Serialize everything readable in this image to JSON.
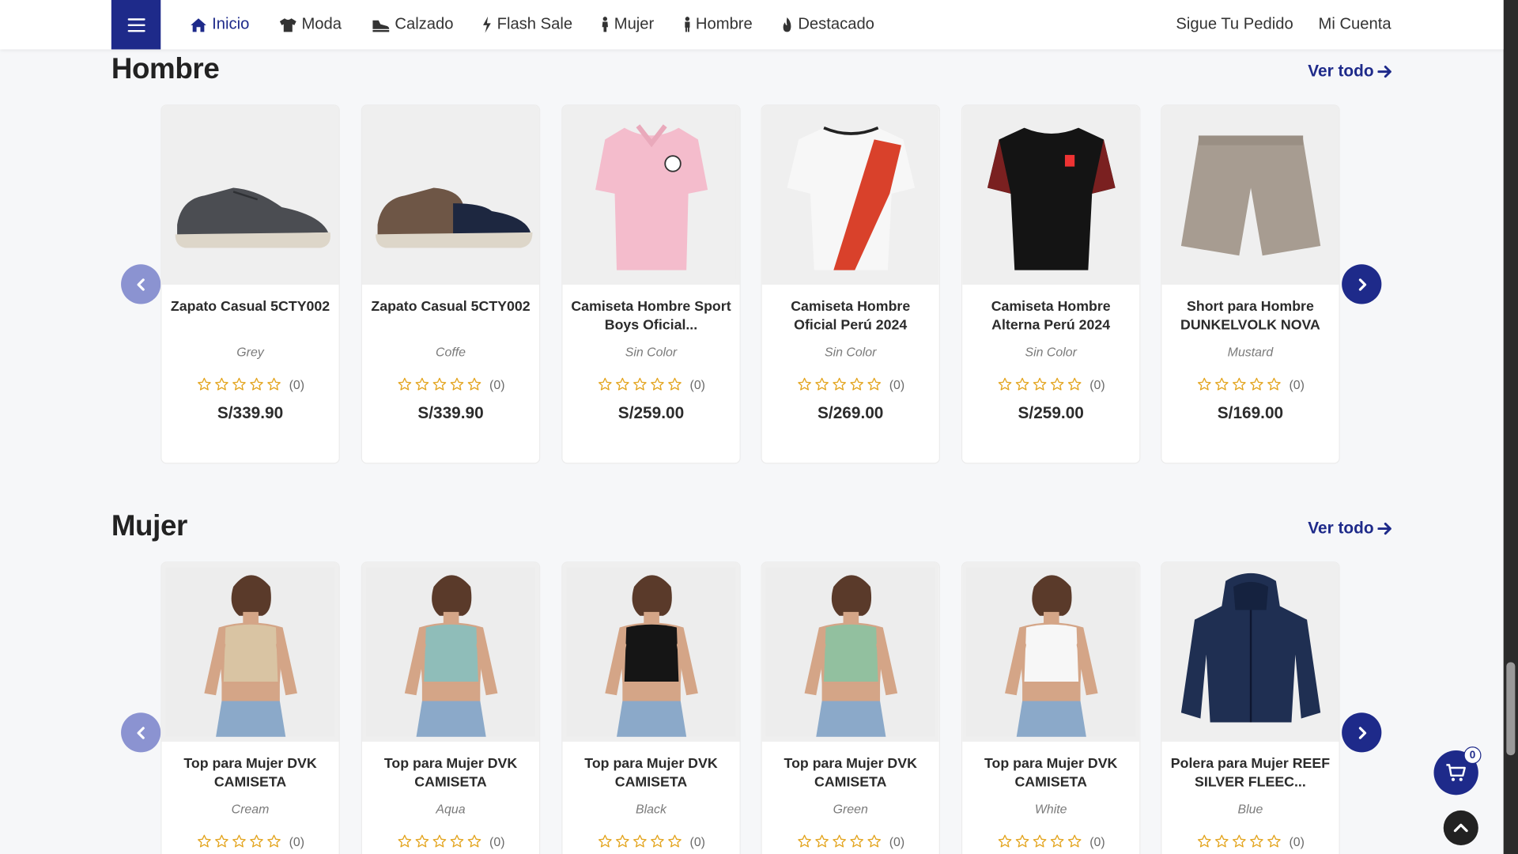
{
  "nav": {
    "items": [
      {
        "label": "Inicio",
        "icon": "home-icon",
        "active": true
      },
      {
        "label": "Moda",
        "icon": "shirt-icon"
      },
      {
        "label": "Calzado",
        "icon": "shoe-icon"
      },
      {
        "label": "Flash Sale",
        "icon": "bolt-icon"
      },
      {
        "label": "Mujer",
        "icon": "female-icon"
      },
      {
        "label": "Hombre",
        "icon": "male-icon"
      },
      {
        "label": "Destacado",
        "icon": "fire-icon"
      }
    ],
    "right": {
      "track": "Sigue Tu Pedido",
      "account": "Mi Cuenta"
    }
  },
  "sections": [
    {
      "title": "Hombre",
      "see_all": "Ver todo",
      "products": [
        {
          "name": "Zapato Casual 5CTY002",
          "variant": "Grey",
          "reviews": "(0)",
          "price": "S/339.90",
          "image": "shoe-grey"
        },
        {
          "name": "Zapato Casual 5CTY002",
          "variant": "Coffe",
          "reviews": "(0)",
          "price": "S/339.90",
          "image": "shoe-coffee"
        },
        {
          "name": "Camiseta Hombre Sport Boys Oficial...",
          "variant": "Sin Color",
          "reviews": "(0)",
          "price": "S/259.00",
          "image": "shirt-pink"
        },
        {
          "name": "Camiseta Hombre Oficial Perú 2024",
          "variant": "Sin Color",
          "reviews": "(0)",
          "price": "S/269.00",
          "image": "shirt-peru-white"
        },
        {
          "name": "Camiseta Hombre Alterna Perú 2024",
          "variant": "Sin Color",
          "reviews": "(0)",
          "price": "S/259.00",
          "image": "shirt-peru-black"
        },
        {
          "name": "Short para Hombre DUNKELVOLK NOVA",
          "variant": "Mustard",
          "reviews": "(0)",
          "price": "S/169.00",
          "image": "shorts-khaki"
        }
      ]
    },
    {
      "title": "Mujer",
      "see_all": "Ver todo",
      "products": [
        {
          "name": "Top para Mujer DVK CAMISETA",
          "variant": "Cream",
          "reviews": "(0)",
          "image": "top-cream"
        },
        {
          "name": "Top para Mujer DVK CAMISETA",
          "variant": "Aqua",
          "reviews": "(0)",
          "image": "top-aqua"
        },
        {
          "name": "Top para Mujer DVK CAMISETA",
          "variant": "Black",
          "reviews": "(0)",
          "image": "top-black"
        },
        {
          "name": "Top para Mujer DVK CAMISETA",
          "variant": "Green",
          "reviews": "(0)",
          "image": "top-green"
        },
        {
          "name": "Top para Mujer DVK CAMISETA",
          "variant": "White",
          "reviews": "(0)",
          "image": "top-white"
        },
        {
          "name": "Polera para Mujer REEF SILVER FLEEC...",
          "variant": "Blue",
          "reviews": "(0)",
          "image": "hoodie-navy"
        }
      ]
    }
  ],
  "cart": {
    "count": "0"
  },
  "colors": {
    "brand": "#1e2a8a",
    "brand_light": "#8b93d1",
    "star": "#e3a31b"
  }
}
